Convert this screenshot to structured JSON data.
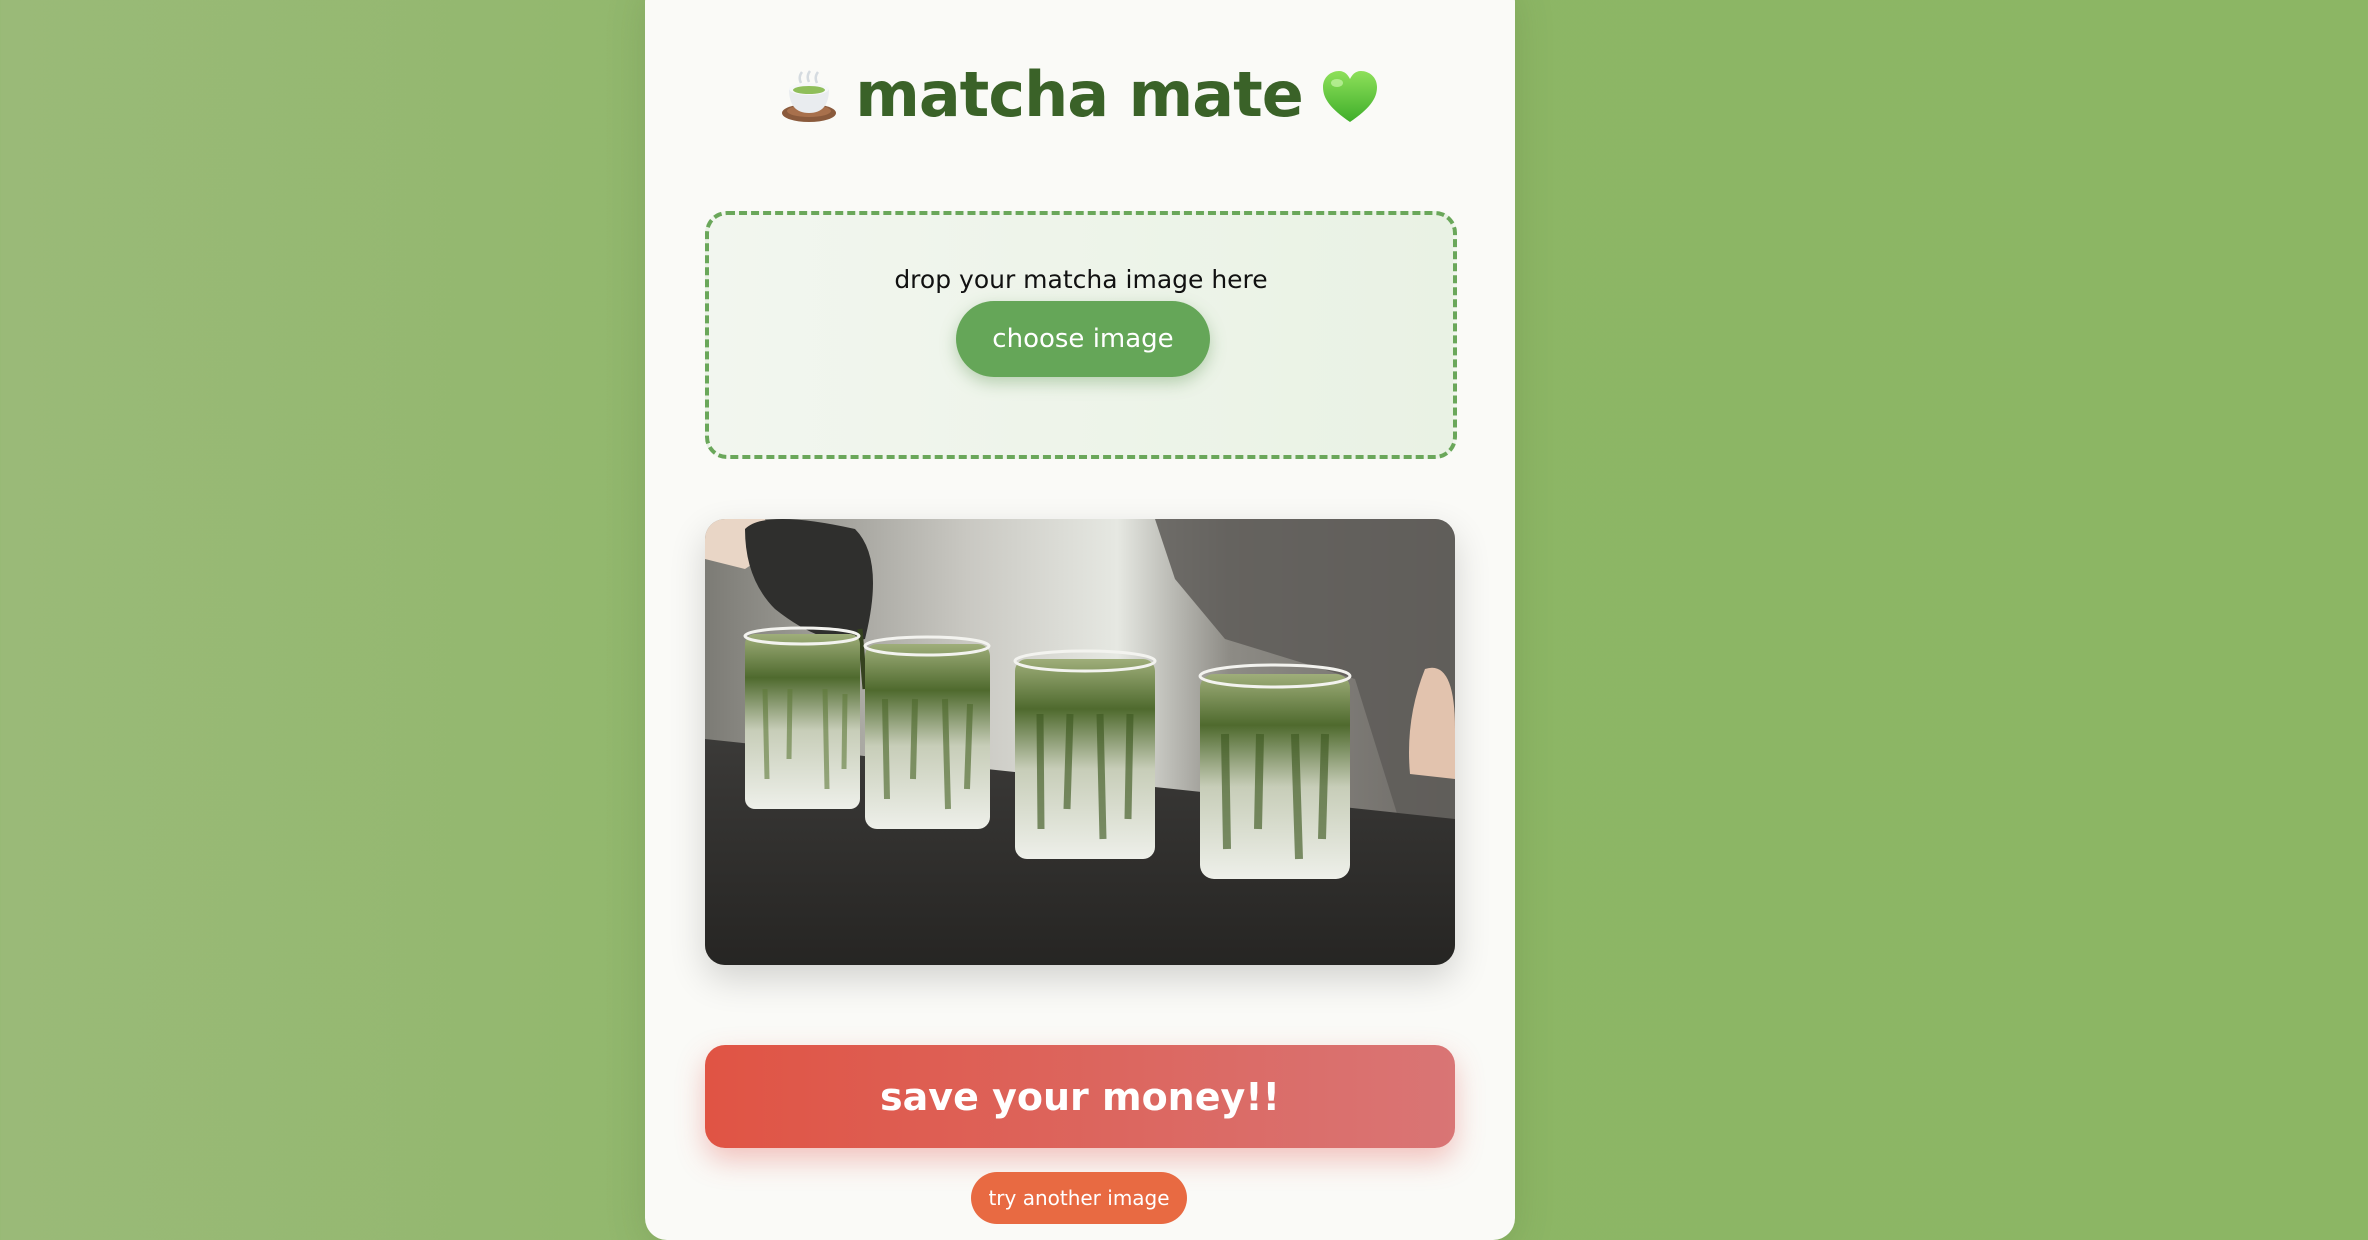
{
  "app": {
    "title": "matcha mate",
    "title_leading_icon": "teacup-icon",
    "title_trailing_icon": "green-heart-icon"
  },
  "upload": {
    "prompt": "drop your matcha image here",
    "button_label": "choose image"
  },
  "preview": {
    "image_icon": "matcha-glasses-photo"
  },
  "result": {
    "verdict": "save your money!!",
    "retry_label": "try another image"
  },
  "colors": {
    "background": "#8db666",
    "card": "#fafaf7",
    "title": "#3a6228",
    "accent_green": "#65a658",
    "verdict_red": "#e05444",
    "retry_orange": "#e86a42"
  }
}
